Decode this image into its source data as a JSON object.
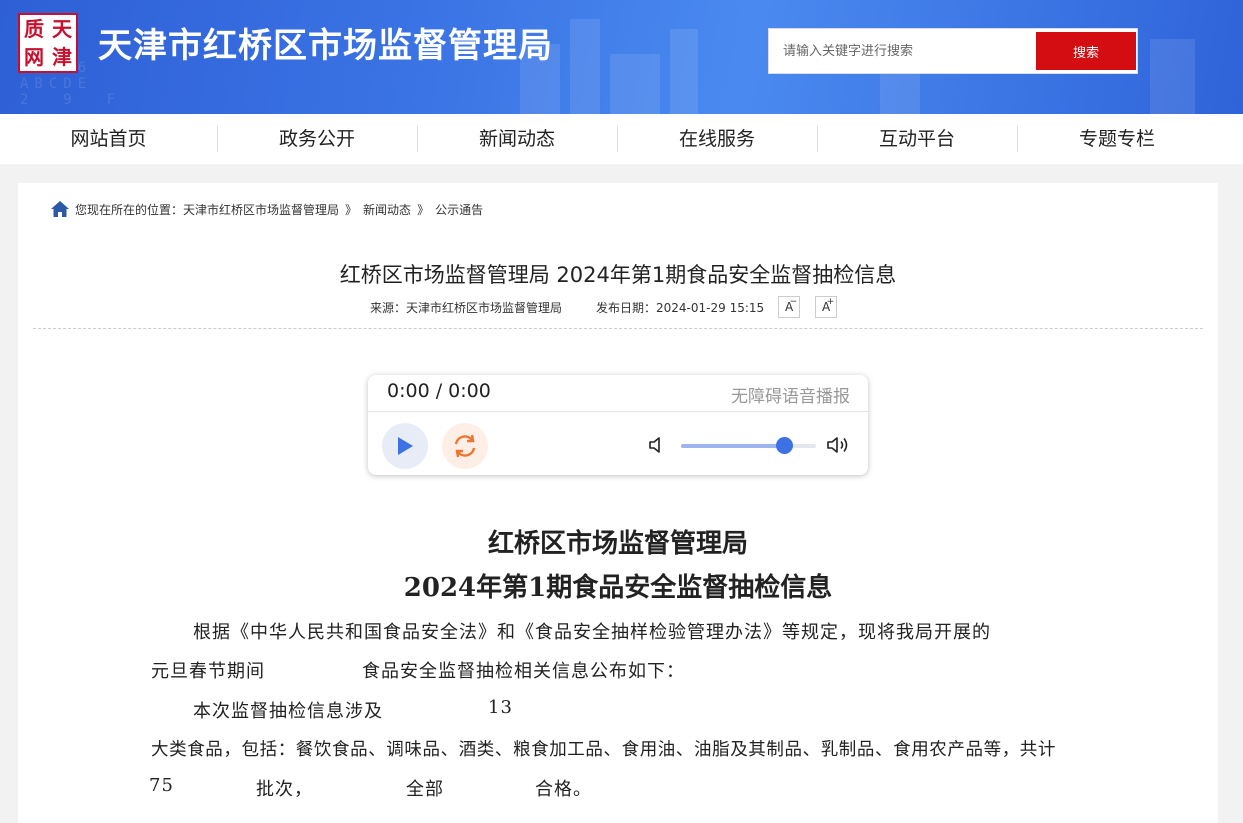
{
  "header": {
    "logo_chars": [
      "天",
      "津",
      "质",
      "网"
    ],
    "site_title": "天津市红桥区市场监督管理局",
    "search_placeholder": "请输入关键字进行搜索",
    "search_button": "搜索",
    "brand_color": "#d40d12",
    "banner_color": "#3b74e4"
  },
  "nav": {
    "items": [
      "网站首页",
      "政务公开",
      "新闻动态",
      "在线服务",
      "互动平台",
      "专题专栏"
    ]
  },
  "breadcrumb": {
    "prefix": "您现在所在的位置：",
    "items": [
      "天津市红桥区市场监督管理局",
      "新闻动态",
      "公示通告"
    ],
    "separator": "》"
  },
  "article": {
    "title": "红桥区市场监督管理局 2024年第1期食品安全监督抽检信息",
    "source": "来源：天津市红桥区市场监督管理局",
    "date": "发布日期：2024-01-29 15:15",
    "font_decrease": "A",
    "font_decrease_sup": "−",
    "font_increase": "A",
    "font_increase_sup": "+"
  },
  "player": {
    "time": "0:00 / 0:00",
    "label": "无障碍语音播报",
    "volume_fraction": 0.77
  },
  "document": {
    "title_line1": "红桥区市场监督管理局",
    "title_line2": "2024年第1期食品安全监督抽检信息",
    "p1_line1": "根据《中华人民共和国食品安全法》和《食品安全抽样检验管理办法》等规定，现将我局开展的",
    "p1_line2a": "元旦春节期间",
    "p1_line2b": "食品安全监督抽检相关信息公布如下：",
    "p2_line1a": "本次监督抽检信息涉及",
    "p2_line1b": "13",
    "p2_line2": "大类食品，包括：餐饮食品、调味品、酒类、粮食加工品、食用油、油脂及其制品、乳制品、食用农产品等，共计",
    "p2_line3a": "75",
    "p2_line3b": "批次，",
    "p2_line3c": "全部",
    "p2_line3d": "合格。"
  }
}
